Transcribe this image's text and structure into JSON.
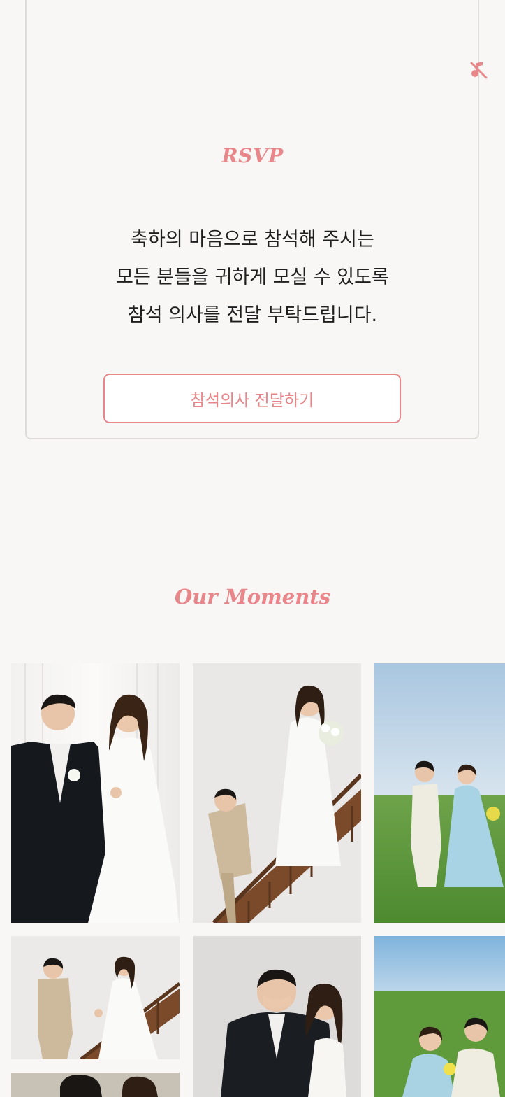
{
  "music": {
    "icon": "music-off-icon",
    "color": "#e8868a"
  },
  "rsvp": {
    "title": "RSVP",
    "message_lines": [
      "축하의 마음으로 참석해 주시는",
      "모든 분들을 귀하게 모실 수 있도록",
      "참석 의사를 전달 부탁드립니다."
    ],
    "button_label": "참석의사 전달하기"
  },
  "gallery": {
    "title": "Our Moments",
    "photos": [
      {
        "scene": "couple in black suit and strapless gown walking hand in hand by window"
      },
      {
        "scene": "bride on staircase reaching to groom in beige suit"
      },
      {
        "scene": "couple in light suit and blue gown on green field"
      },
      {
        "scene": "groom and bride holding hands near staircase"
      },
      {
        "scene": "bride covering groom's mouth playfully"
      },
      {
        "scene": "couple sitting on grass field with flowers"
      },
      {
        "scene": "couple portrait partially visible"
      }
    ]
  },
  "colors": {
    "accent": "#e8868a",
    "background": "#f9f7f5",
    "text": "#1f1f1f"
  }
}
